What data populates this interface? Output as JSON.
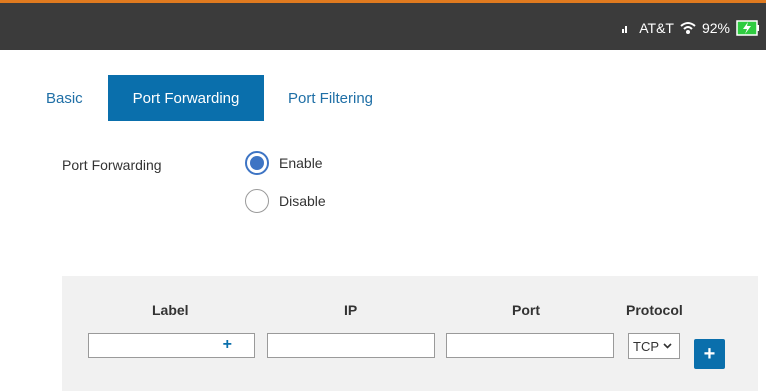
{
  "status_bar": {
    "carrier": "AT&T",
    "battery_percent": "92%",
    "accent_color": "#e07a1f",
    "background_color": "#3b3b3b"
  },
  "tabs": [
    {
      "label": "Basic",
      "active": false
    },
    {
      "label": "Port Forwarding",
      "active": true
    },
    {
      "label": "Port Filtering",
      "active": false
    }
  ],
  "port_forwarding": {
    "label": "Port Forwarding",
    "options": [
      {
        "label": "Enable",
        "checked": true
      },
      {
        "label": "Disable",
        "checked": false
      }
    ]
  },
  "table": {
    "headers": {
      "label": "Label",
      "ip": "IP",
      "port": "Port",
      "protocol": "Protocol"
    },
    "label_value": "",
    "ip_value": "",
    "port_value": "",
    "protocol_selected": "TCP",
    "inline_add_symbol": "+",
    "add_symbol": "+"
  },
  "colors": {
    "primary": "#0a6fac",
    "radio": "#3d74c4",
    "panel": "#f1f1f1"
  },
  "icons": [
    "signal-icon",
    "wifi-icon",
    "battery-charging-icon",
    "chevron-down-icon",
    "plus-icon"
  ]
}
